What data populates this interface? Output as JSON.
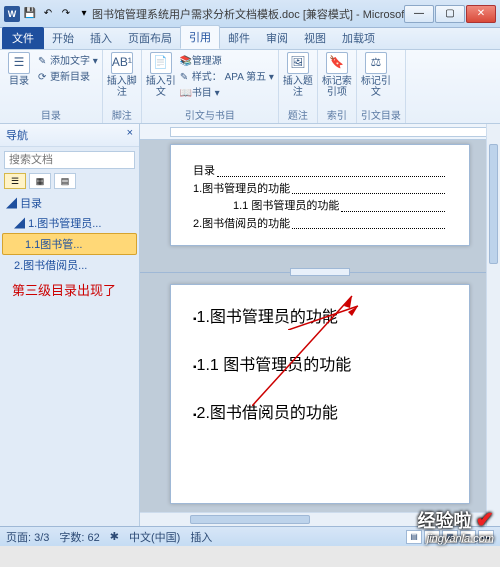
{
  "title_bar": {
    "app_icon_text": "W",
    "doc_title": "图书馆管理系统用户需求分析文档模板.doc [兼容模式] - Microsoft Word"
  },
  "tabs": {
    "file": "文件",
    "items": [
      "开始",
      "插入",
      "页面布局",
      "引用",
      "邮件",
      "审阅",
      "视图",
      "加载项"
    ],
    "active_index": 3
  },
  "ribbon": {
    "group1": {
      "label": "目录",
      "big": "目录",
      "small1": "添加文字 ▾",
      "small2": "更新目录"
    },
    "group2": {
      "label": "脚注",
      "big": "插入脚注",
      "big_sup": "AB¹"
    },
    "group3": {
      "label": "引文与书目",
      "big": "插入引文",
      "small1": "管理源",
      "small2": "样式：",
      "small3": "APA 第五 ▾",
      "small4": "书目 ▾"
    },
    "group4": {
      "label": "题注",
      "big": "插入题注"
    },
    "group5": {
      "label": "索引",
      "big": "标记索引项"
    },
    "group6": {
      "label": "引文目录",
      "big": "标记引文"
    }
  },
  "nav": {
    "title": "导航",
    "close": "×",
    "search_placeholder": "搜索文档",
    "tree": {
      "root": "目录",
      "item1": "1.图书管理员...",
      "item11": "1.1图书管...",
      "item2": "2.图书借阅员..."
    }
  },
  "document": {
    "toc_title": "目录",
    "toc1": "1.图书管理员的功能",
    "toc11": "1.1 图书管理员的功能",
    "toc2": "2.图书借阅员的功能",
    "h1": "1.图书管理员的功能",
    "h11": "1.1 图书管理员的功能",
    "h2": "2.图书借阅员的功能"
  },
  "callout": "第三级目录出现了",
  "status": {
    "page": "页面: 3/3",
    "words": "字数: 62",
    "lang": "中文(中国)",
    "mode": "插入"
  },
  "watermark": {
    "brand": "经验啦",
    "url": "jingyanla.com"
  }
}
